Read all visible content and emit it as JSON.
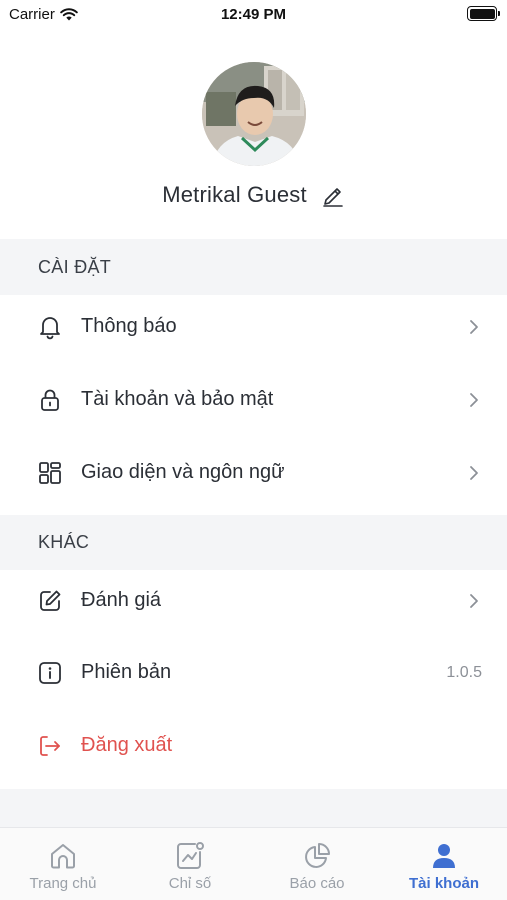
{
  "status_bar": {
    "carrier": "Carrier",
    "time": "12:49 PM"
  },
  "profile": {
    "name": "Metrikal Guest"
  },
  "settings_section": {
    "title": "CÀI ĐẶT",
    "items": [
      {
        "label": "Thông báo",
        "icon": "bell-icon"
      },
      {
        "label": "Tài khoản và bảo mật",
        "icon": "lock-icon"
      },
      {
        "label": "Giao diện và ngôn ngữ",
        "icon": "layout-grid-icon"
      }
    ]
  },
  "other_section": {
    "title": "KHÁC",
    "items": [
      {
        "label": "Đánh giá",
        "icon": "edit-square-icon"
      },
      {
        "label": "Phiên bản",
        "icon": "info-icon",
        "value": "1.0.5"
      },
      {
        "label": "Đăng xuất",
        "icon": "logout-icon"
      }
    ]
  },
  "tab_bar": {
    "tabs": [
      {
        "label": "Trang chủ",
        "icon": "home-icon"
      },
      {
        "label": "Chỉ số",
        "icon": "chart-icon"
      },
      {
        "label": "Báo cáo",
        "icon": "pie-chart-icon"
      },
      {
        "label": "Tài khoản",
        "icon": "user-icon"
      }
    ],
    "active_index": 3
  },
  "colors": {
    "accent": "#3f6fd1",
    "danger": "#e0524f",
    "section_bg": "#f4f5f7"
  }
}
